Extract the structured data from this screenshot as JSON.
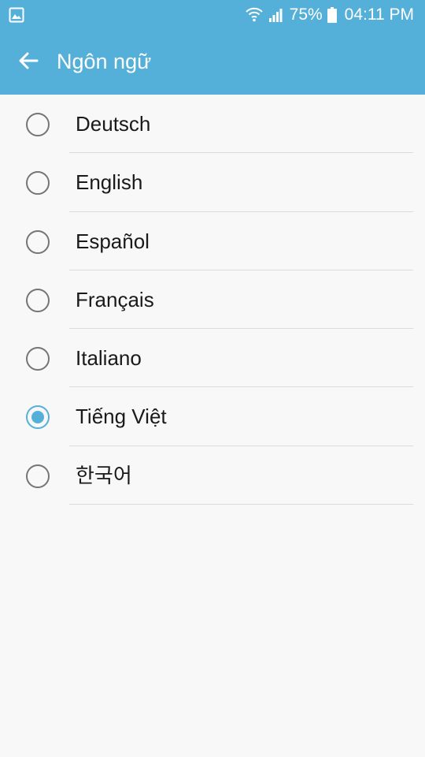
{
  "status_bar": {
    "battery": "75%",
    "time": "04:11 PM",
    "icons": [
      "image-notification-icon",
      "wifi-icon",
      "signal-icon",
      "battery-icon"
    ]
  },
  "app_bar": {
    "title": "Ngôn ngữ",
    "back_icon": "arrow-left-icon"
  },
  "colors": {
    "accent": "#54b0d8",
    "background": "#f8f8f8",
    "text": "#1a1a1a",
    "radio_unchecked": "#757575",
    "divider": "#dcdcdc"
  },
  "languages": [
    {
      "label": "Deutsch",
      "selected": false
    },
    {
      "label": "English",
      "selected": false
    },
    {
      "label": "Español",
      "selected": false
    },
    {
      "label": "Français",
      "selected": false
    },
    {
      "label": "Italiano",
      "selected": false
    },
    {
      "label": "Tiếng Việt",
      "selected": true
    },
    {
      "label": "한국어",
      "selected": false
    }
  ]
}
